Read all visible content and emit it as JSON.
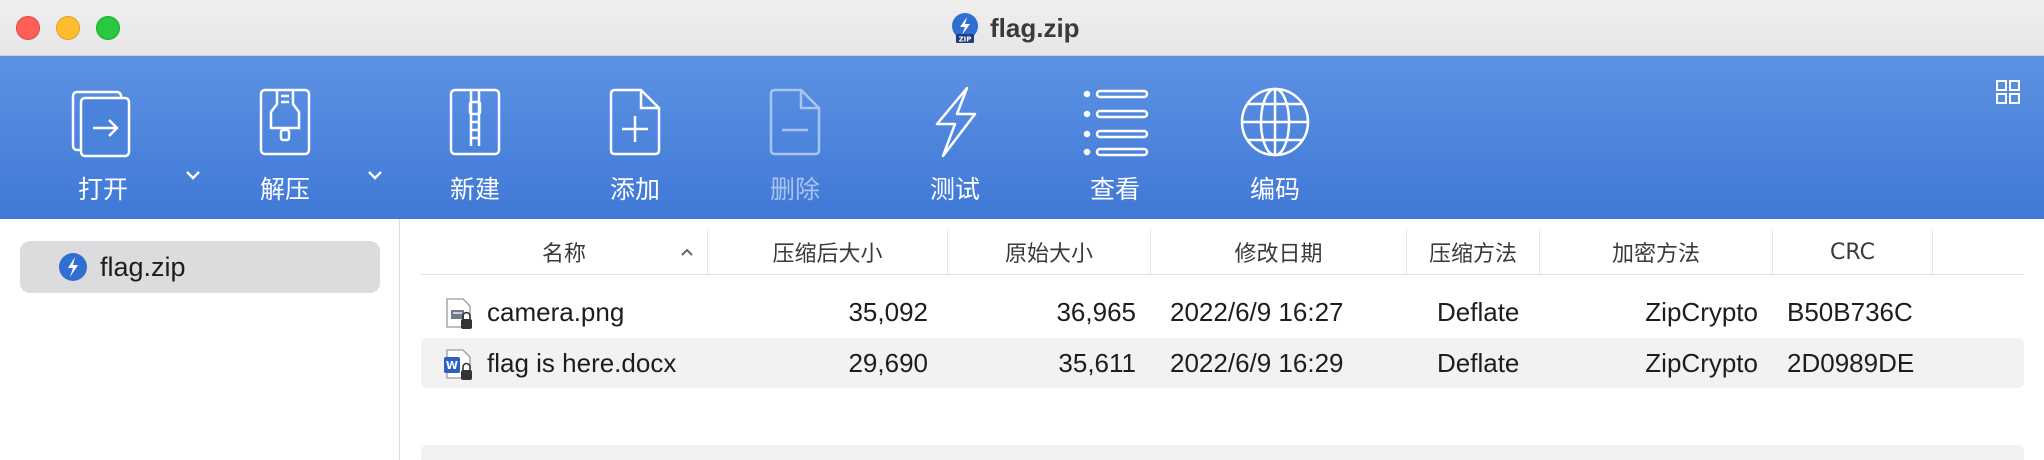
{
  "window": {
    "title": "flag.zip",
    "title_icon": "zip-archive-icon"
  },
  "toolbar": {
    "open_label": "打开",
    "extract_label": "解压",
    "new_label": "新建",
    "add_label": "添加",
    "delete_label": "删除",
    "test_label": "测试",
    "view_label": "查看",
    "encoding_label": "编码",
    "accent": "#4a82dc"
  },
  "sidebar": {
    "items": [
      {
        "label": "flag.zip",
        "icon": "zip-archive-icon",
        "selected": true
      }
    ]
  },
  "table": {
    "columns": [
      "名称",
      "压缩后大小",
      "原始大小",
      "修改日期",
      "压缩方法",
      "加密方法",
      "CRC"
    ],
    "sort_indicator": "chevron-up-icon",
    "rows": [
      {
        "name": "camera.png",
        "icon": "png-locked-file-icon",
        "compressed": "35,092",
        "original": "36,965",
        "modified": "2022/6/9 16:27",
        "method": "Deflate",
        "encryption": "ZipCrypto",
        "crc": "B50B736C"
      },
      {
        "name": "flag is here.docx",
        "icon": "word-locked-file-icon",
        "compressed": "29,690",
        "original": "35,611",
        "modified": "2022/6/9 16:29",
        "method": "Deflate",
        "encryption": "ZipCrypto",
        "crc": "2D0989DE"
      }
    ]
  }
}
